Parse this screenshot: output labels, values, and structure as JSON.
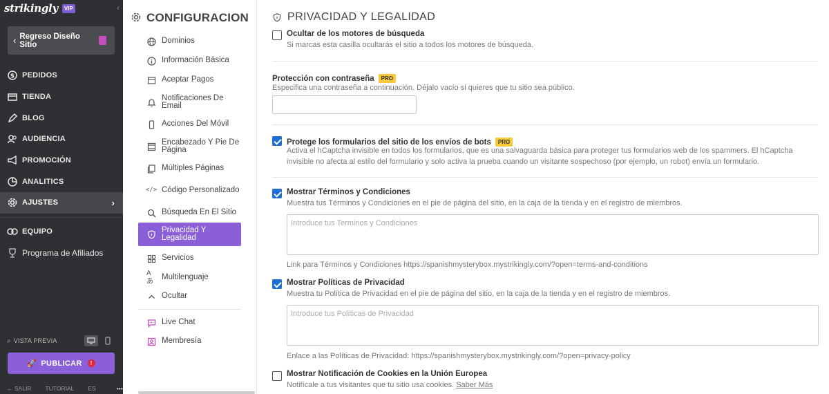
{
  "sidebar": {
    "logo": "strikingly",
    "vip_badge": "VIP",
    "back_label": "Regreso Diseño Sitio",
    "items": [
      {
        "label": "PEDIDOS",
        "icon": "dollar-icon"
      },
      {
        "label": "TIENDA",
        "icon": "store-icon"
      },
      {
        "label": "BLOG",
        "icon": "pen-icon"
      },
      {
        "label": "AUDIENCIA",
        "icon": "people-icon"
      },
      {
        "label": "PROMOCIÓN",
        "icon": "megaphone-icon"
      },
      {
        "label": "ANALITICS",
        "icon": "chart-icon"
      },
      {
        "label": "AJUSTES",
        "icon": "gear-icon"
      }
    ],
    "team_label": "EQUIPO",
    "affiliates_label": "Programa de Afiliados",
    "preview_label": "VISTA PREVIA",
    "publish_label": "PUBLICAR",
    "bottom": {
      "salir": "SALIR",
      "tutorial": "TUTORIAL",
      "lang": "ES",
      "more": "•••"
    }
  },
  "settings": {
    "title": "CONFIGURACION",
    "items": [
      {
        "label": "Dominios",
        "icon": "globe-icon"
      },
      {
        "label": "Información Básica",
        "icon": "info-icon"
      },
      {
        "label": "Aceptar Pagos",
        "icon": "payment-icon"
      },
      {
        "label": "Notificaciones De Email",
        "icon": "bell-icon"
      },
      {
        "label": "Acciones Del Móvil",
        "icon": "mobile-icon"
      },
      {
        "label": "Encabezado Y Pie De Página",
        "icon": "layout-icon"
      },
      {
        "label": "Múltiples Páginas",
        "icon": "pages-icon"
      },
      {
        "label": "Código Personalizado",
        "icon": "code-icon"
      },
      {
        "label": "Búsqueda En El Sitio",
        "icon": "search-icon"
      },
      {
        "label": "Privacidad Y Legalidad",
        "icon": "shield-icon"
      },
      {
        "label": "Servicios",
        "icon": "grid-icon"
      },
      {
        "label": "Multilenguaje",
        "icon": "language-icon"
      },
      {
        "label": "Ocultar",
        "icon": "chevron-up-icon"
      }
    ],
    "extra": [
      {
        "label": "Live Chat",
        "icon": "chat-icon"
      },
      {
        "label": "Membresía",
        "icon": "member-icon"
      }
    ]
  },
  "content": {
    "title": "PRIVACIDAD Y LEGALIDAD",
    "pro_badge": "PRO",
    "hide_search": {
      "label": "Ocultar de los motores de búsqueda",
      "desc": "Si marcas esta casilla ocultarás el sitio a todos los motores de búsqueda.",
      "checked": false
    },
    "password": {
      "label": "Protección con contraseña",
      "desc": "Especifica una contraseña a continuación. Déjalo vacío si quieres que tu sitio sea público.",
      "value": ""
    },
    "bots": {
      "label": "Protege los formularios del sitio de los envíos de bots",
      "desc": "Activa el hCaptcha invisible en todos los formularios, que es una salvaguarda básica para proteger tus formularios web de los spammers. El hCaptcha invisible no afecta al estilo del formulario y solo activa la prueba cuando un visitante sospechoso (por ejemplo, un robot) envía un formulario.",
      "checked": true
    },
    "terms": {
      "label": "Mostrar Términos y Condiciones",
      "desc": "Muestra tus Términos y Condiciones en el pie de página del sitio, en la caja de la tienda y en el registro de miembros.",
      "placeholder": "Introduce tus Terminos y Condiciones",
      "link": "Link para Términos y Condiciones https://spanishmysterybox.mystrikingly.com/?open=terms-and-conditions",
      "checked": true
    },
    "privacy": {
      "label": "Mostrar Políticas de Privacidad",
      "desc": "Muestra tu Política de Privacidad en el pie de página del sitio, en la caja de la tienda y en el registro de miembros.",
      "placeholder": "Introduce tus Políticas de Privacidad",
      "link": "Enlace a las Políticas de Privacidad: https://spanishmysterybox.mystrikingly.com/?open=privacy-policy",
      "checked": true
    },
    "cookies": {
      "label": "Mostrar Notificación de Cookies en la Unión Europea",
      "desc": "Notifícale a tus visitantes que tu sitio usa cookies.",
      "more": "Saber Más",
      "checked": false
    }
  }
}
